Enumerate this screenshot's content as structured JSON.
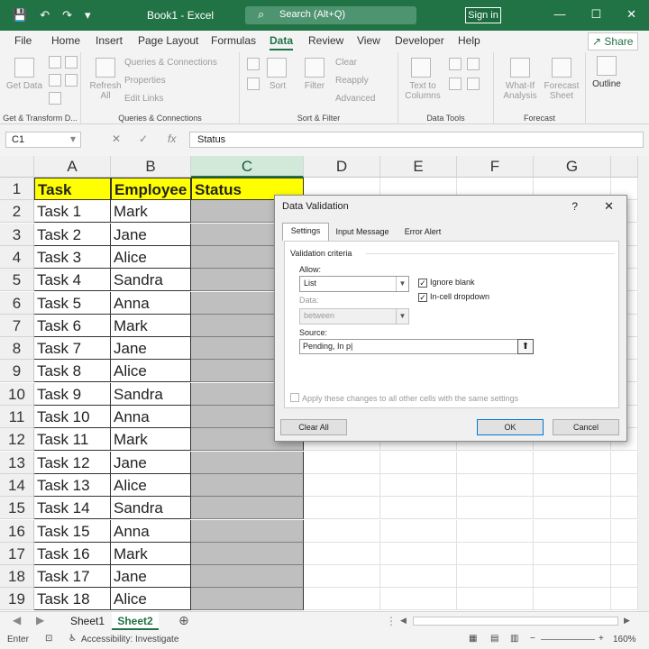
{
  "titlebar": {
    "title": "Book1 - Excel",
    "search_placeholder": "Search (Alt+Q)",
    "signin_label": "Sign in"
  },
  "ribbon_tabs": [
    "File",
    "Home",
    "Insert",
    "Page Layout",
    "Formulas",
    "Data",
    "Review",
    "View",
    "Developer",
    "Help"
  ],
  "active_tab": "Data",
  "share_label": "Share",
  "ribbon": {
    "get_data": "Get Data",
    "get_transform_label": "Get & Transform D...",
    "refresh_all": "Refresh All",
    "queries_connections": "Queries & Connections",
    "properties": "Properties",
    "edit_links": "Edit Links",
    "queries_group_label": "Queries & Connections",
    "sort": "Sort",
    "filter": "Filter",
    "clear": "Clear",
    "reapply": "Reapply",
    "advanced": "Advanced",
    "sort_filter_label": "Sort & Filter",
    "text_to_columns": "Text to Columns",
    "data_tools_label": "Data Tools",
    "what_if": "What-If Analysis",
    "forecast_sheet": "Forecast Sheet",
    "forecast_label": "Forecast",
    "outline": "Outline"
  },
  "formula_bar": {
    "name_box": "C1",
    "fx": "fx",
    "content": "Status"
  },
  "columns": [
    "A",
    "B",
    "C",
    "D",
    "E",
    "F",
    "G"
  ],
  "rows": [
    {
      "n": "1",
      "a": "Task",
      "b": "Employee",
      "c": "Status"
    },
    {
      "n": "2",
      "a": "Task 1",
      "b": "Mark",
      "c": ""
    },
    {
      "n": "3",
      "a": "Task 2",
      "b": "Jane",
      "c": ""
    },
    {
      "n": "4",
      "a": "Task 3",
      "b": "Alice",
      "c": ""
    },
    {
      "n": "5",
      "a": "Task 4",
      "b": "Sandra",
      "c": ""
    },
    {
      "n": "6",
      "a": "Task 5",
      "b": "Anna",
      "c": ""
    },
    {
      "n": "7",
      "a": "Task 6",
      "b": "Mark",
      "c": ""
    },
    {
      "n": "8",
      "a": "Task 7",
      "b": "Jane",
      "c": ""
    },
    {
      "n": "9",
      "a": "Task 8",
      "b": "Alice",
      "c": ""
    },
    {
      "n": "10",
      "a": "Task 9",
      "b": "Sandra",
      "c": ""
    },
    {
      "n": "11",
      "a": "Task 10",
      "b": "Anna",
      "c": ""
    },
    {
      "n": "12",
      "a": "Task 11",
      "b": "Mark",
      "c": ""
    },
    {
      "n": "13",
      "a": "Task 12",
      "b": "Jane",
      "c": ""
    },
    {
      "n": "14",
      "a": "Task 13",
      "b": "Alice",
      "c": ""
    },
    {
      "n": "15",
      "a": "Task 14",
      "b": "Sandra",
      "c": ""
    },
    {
      "n": "16",
      "a": "Task 15",
      "b": "Anna",
      "c": ""
    },
    {
      "n": "17",
      "a": "Task 16",
      "b": "Mark",
      "c": ""
    },
    {
      "n": "18",
      "a": "Task 17",
      "b": "Jane",
      "c": ""
    },
    {
      "n": "19",
      "a": "Task 18",
      "b": "Alice",
      "c": ""
    }
  ],
  "sheets": [
    "Sheet1",
    "Sheet2"
  ],
  "active_sheet": "Sheet2",
  "status": {
    "mode": "Enter",
    "accessibility": "Accessibility: Investigate",
    "zoom": "160%"
  },
  "dialog": {
    "title": "Data Validation",
    "help": "?",
    "tabs": [
      "Settings",
      "Input Message",
      "Error Alert"
    ],
    "criteria_label": "Validation criteria",
    "allow_label": "Allow:",
    "allow_value": "List",
    "data_label": "Data:",
    "data_value": "between",
    "ignore_blank": "Ignore blank",
    "in_cell_dropdown": "In-cell dropdown",
    "source_label": "Source:",
    "source_value": "Pending, In p",
    "apply_all": "Apply these changes to all other cells with the same settings",
    "clear_all": "Clear All",
    "ok": "OK",
    "cancel": "Cancel"
  },
  "colors": {
    "excel_green": "#217346",
    "header_yellow": "#ffff00",
    "status_fill": "#bfbfbf"
  }
}
